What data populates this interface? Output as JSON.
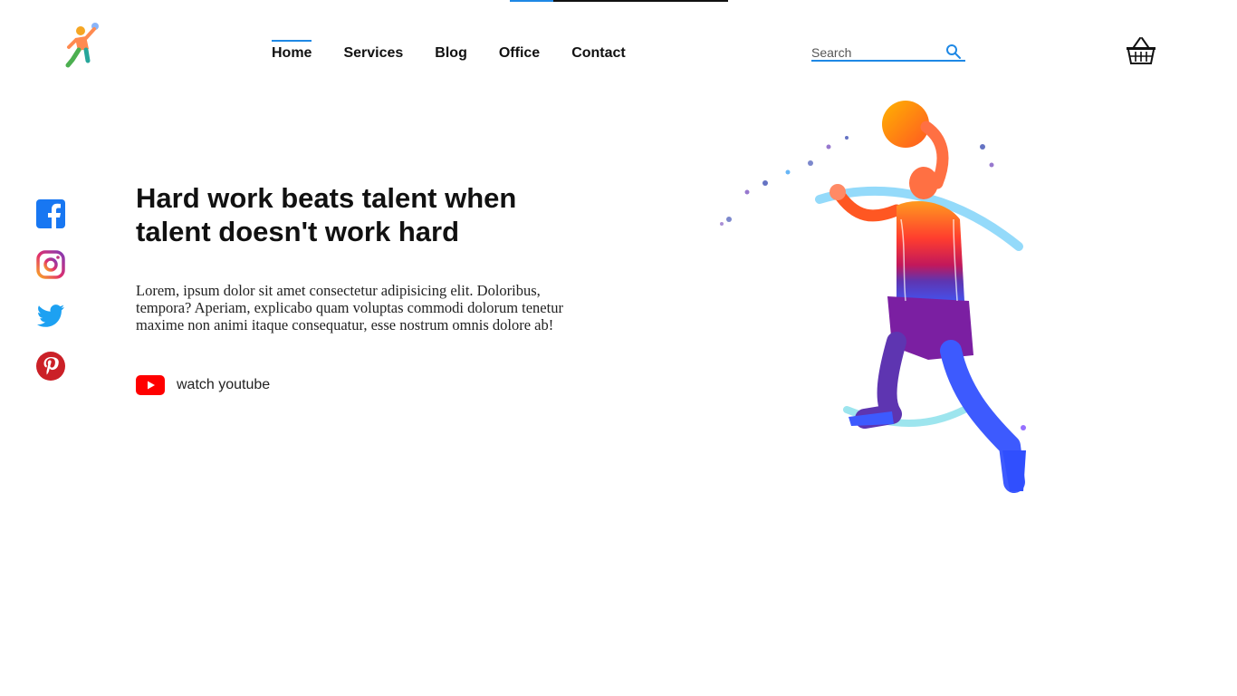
{
  "header": {
    "loading_progress": 0.2,
    "nav": [
      {
        "label": "Home",
        "active": true
      },
      {
        "label": "Services",
        "active": false
      },
      {
        "label": "Blog",
        "active": false
      },
      {
        "label": "Office",
        "active": false
      },
      {
        "label": "Contact",
        "active": false
      }
    ],
    "search": {
      "placeholder": "Search",
      "value": "",
      "icon": "search-icon"
    },
    "cart_icon": "basket-icon",
    "logo_icon": "basketball-player-logo"
  },
  "social": [
    {
      "name": "facebook",
      "icon": "facebook-icon",
      "color": "#1877f2"
    },
    {
      "name": "instagram",
      "icon": "instagram-icon",
      "color": "#c13584"
    },
    {
      "name": "twitter",
      "icon": "twitter-icon",
      "color": "#1da1f2"
    },
    {
      "name": "pinterest",
      "icon": "pinterest-icon",
      "color": "#cb2027"
    }
  ],
  "hero": {
    "title": "Hard work beats talent when talent doesn't work hard",
    "body": "Lorem, ipsum dolor sit amet consectetur adipisicing elit. Doloribus, tempora? Aperiam, explicabo quam voluptas commodi dolorum tenetur maxime non animi itaque consequatur, esse nostrum omnis dolore ab!",
    "cta": {
      "label": "watch youtube",
      "icon": "youtube-icon",
      "color": "#ff0000"
    },
    "illustration": "watercolor-basketball-player"
  },
  "colors": {
    "accent": "#1e88e5",
    "text": "#111111",
    "background": "#ffffff"
  }
}
